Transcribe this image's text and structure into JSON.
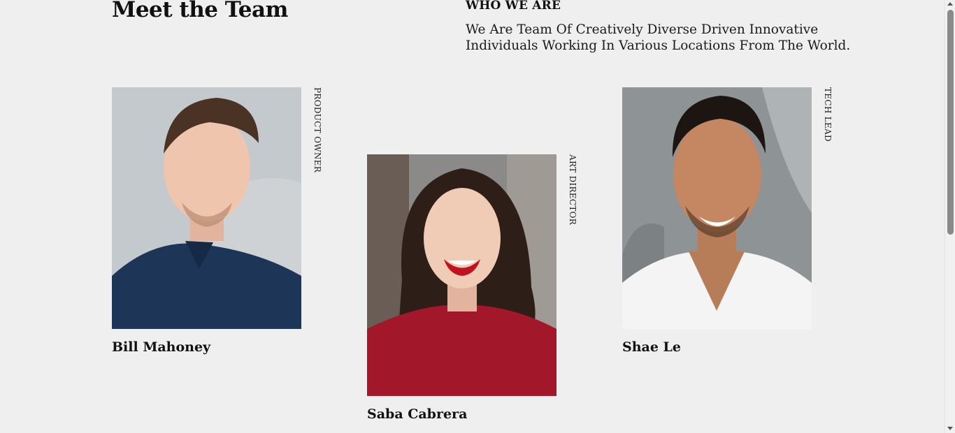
{
  "page": {
    "title": "Meet the Team"
  },
  "intro": {
    "heading": "WHO WE ARE",
    "text": "We Are Team Of Creatively Diverse Driven Innovative Individuals Working In Various Locations From The World."
  },
  "team": [
    {
      "name": "Bill Mahoney",
      "role": "PRODUCT OWNER"
    },
    {
      "name": "Saba Cabrera",
      "role": "ART DIRECTOR"
    },
    {
      "name": "Shae Le",
      "role": "TECH LEAD"
    }
  ],
  "colors": {
    "background": "#efefef",
    "text": "#111111"
  }
}
